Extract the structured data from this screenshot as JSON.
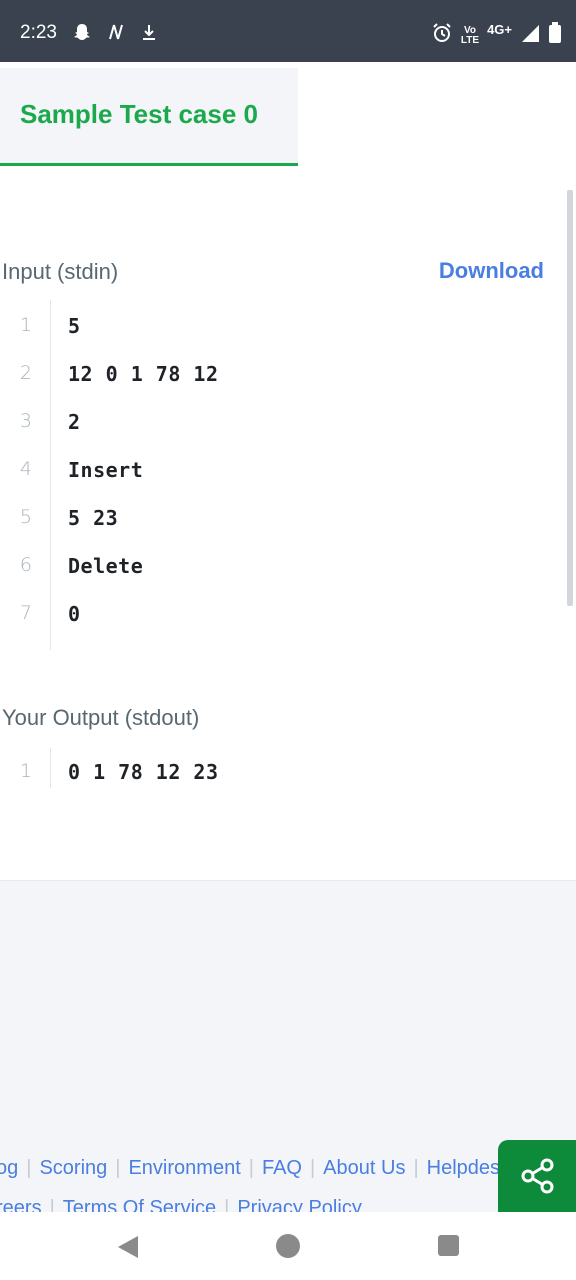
{
  "status_bar": {
    "time": "2:23",
    "left_icons": [
      "snapchat-icon",
      "n-icon",
      "download-icon"
    ],
    "volte_top": "Vo",
    "volte_bottom": "LTE",
    "network": "4G+",
    "right_icons": [
      "alarm-icon",
      "signal-icon",
      "battery-icon"
    ]
  },
  "tab": {
    "label": "Sample Test case 0"
  },
  "input": {
    "title": "Input (stdin)",
    "download_label": "Download",
    "lines": [
      {
        "num": "1",
        "text": "5"
      },
      {
        "num": "2",
        "text": "12 0 1 78 12"
      },
      {
        "num": "3",
        "text": "2"
      },
      {
        "num": "4",
        "text": "Insert"
      },
      {
        "num": "5",
        "text": "5 23"
      },
      {
        "num": "6",
        "text": "Delete"
      },
      {
        "num": "7",
        "text": "0"
      }
    ]
  },
  "output": {
    "title": "Your Output (stdout)",
    "lines": [
      {
        "num": "1",
        "text": "0 1 78 12 23"
      }
    ]
  },
  "footer": {
    "row1": [
      "og",
      "Scoring",
      "Environment",
      "FAQ",
      "About Us",
      "Helpdesk"
    ],
    "row2": [
      "reers",
      "Terms Of Service",
      "Privacy Policy"
    ]
  },
  "colors": {
    "accent_green": "#1ba94c",
    "link_blue": "#4a7ee0",
    "status_bar": "#39424e"
  }
}
